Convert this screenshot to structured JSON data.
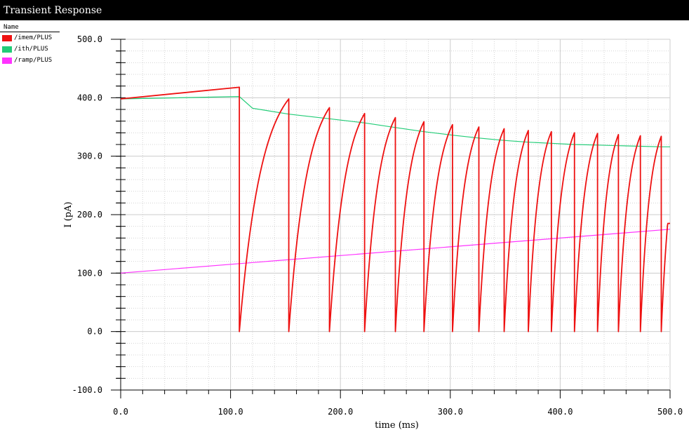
{
  "window": {
    "title": "Transient Response"
  },
  "legend": {
    "header": "Name",
    "items": [
      {
        "label": "/imem/PLUS",
        "color": "#ee1111"
      },
      {
        "label": "/ith/PLUS",
        "color": "#22cc77"
      },
      {
        "label": "/ramp/PLUS",
        "color": "#ff33ff"
      }
    ]
  },
  "chart_data": {
    "type": "line",
    "xlabel": "time (ms)",
    "ylabel": "I (pA)",
    "xlim": [
      0,
      500
    ],
    "ylim": [
      -100,
      500
    ],
    "grid": true,
    "x_ticks": [
      "0.0",
      "100.0",
      "200.0",
      "300.0",
      "400.0",
      "500.0"
    ],
    "y_ticks": [
      "-100.0",
      "0.0",
      "100.0",
      "200.0",
      "300.0",
      "400.0",
      "500.0"
    ],
    "series": [
      {
        "name": "/imem/PLUS",
        "color": "#ee1111",
        "spike_times": [
          108,
          153,
          190,
          222,
          250,
          276,
          302,
          326,
          349,
          371,
          392,
          413,
          434,
          453,
          473,
          492
        ],
        "peak_values": [
          418,
          398,
          383,
          373,
          366,
          359,
          354,
          350,
          347,
          344,
          342,
          340,
          339,
          337,
          335,
          334
        ],
        "initial_value": 398,
        "end_value": 185
      },
      {
        "name": "/ith/PLUS",
        "color": "#22cc77",
        "x": [
          0,
          108,
          120,
          153,
          190,
          222,
          250,
          276,
          302,
          326,
          349,
          371,
          392,
          413,
          434,
          453,
          473,
          492,
          500
        ],
        "y": [
          398,
          402,
          382,
          372,
          364,
          357,
          349,
          342,
          336,
          331,
          327,
          324,
          322,
          320,
          319,
          318,
          317,
          316,
          316
        ]
      },
      {
        "name": "/ramp/PLUS",
        "color": "#ff33ff",
        "x": [
          0,
          500
        ],
        "y": [
          100,
          175
        ]
      }
    ]
  }
}
